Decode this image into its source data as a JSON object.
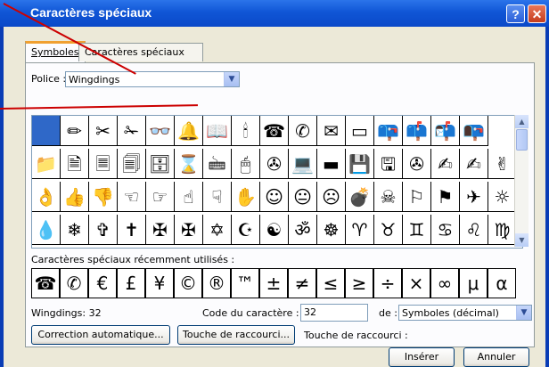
{
  "window": {
    "title": "Caractères spéciaux",
    "help_label": "?",
    "close_label": "✕"
  },
  "tabs": [
    {
      "label": "Symboles"
    },
    {
      "label": "Caractères spéciaux"
    }
  ],
  "font": {
    "label": "Police :",
    "value": "Wingdings"
  },
  "symbols": [
    [
      "",
      "✏",
      "✂",
      "✁",
      "👓",
      "🔔",
      "📖",
      "🕯",
      "☎",
      "✆",
      "✉",
      "▭",
      "📪",
      "📫",
      "📬",
      "📭"
    ],
    [
      "📁",
      "🗎",
      "🗏",
      "🗐",
      "🗄",
      "⌛",
      "🖮",
      "🖱",
      "✇",
      "💻",
      "▬",
      "💾",
      "🖫",
      "✇",
      "✍",
      "✍",
      "✌"
    ],
    [
      "👌",
      "👍",
      "👎",
      "☜",
      "☞",
      "☝",
      "☟",
      "✋",
      "☺",
      "😐",
      "☹",
      "💣",
      "☠",
      "⚐",
      "⚑",
      "✈",
      "☼"
    ],
    [
      "💧",
      "❄",
      "✞",
      "✝",
      "✠",
      "✠",
      "✡",
      "☪",
      "☯",
      "ॐ",
      "☸",
      "♈",
      "♉",
      "♊",
      "♋",
      "♌",
      "♍"
    ]
  ],
  "recent": {
    "label": "Caractères spéciaux récemment utilisés :",
    "symbols": [
      "☎",
      "✆",
      "€",
      "£",
      "¥",
      "©",
      "®",
      "™",
      "±",
      "≠",
      "≤",
      "≥",
      "÷",
      "×",
      "∞",
      "μ",
      "α"
    ]
  },
  "status": {
    "name": "Wingdings: 32",
    "code_label": "Code du caractère :",
    "code_value": "32",
    "from_label": "de :",
    "from_value": "Symboles (décimal)"
  },
  "buttons": {
    "autocorrect": "Correction automatique...",
    "shortcut_key": "Touche de raccourci...",
    "shortcut_label": "Touche de raccourci :",
    "insert": "Insérer",
    "cancel": "Annuler"
  }
}
